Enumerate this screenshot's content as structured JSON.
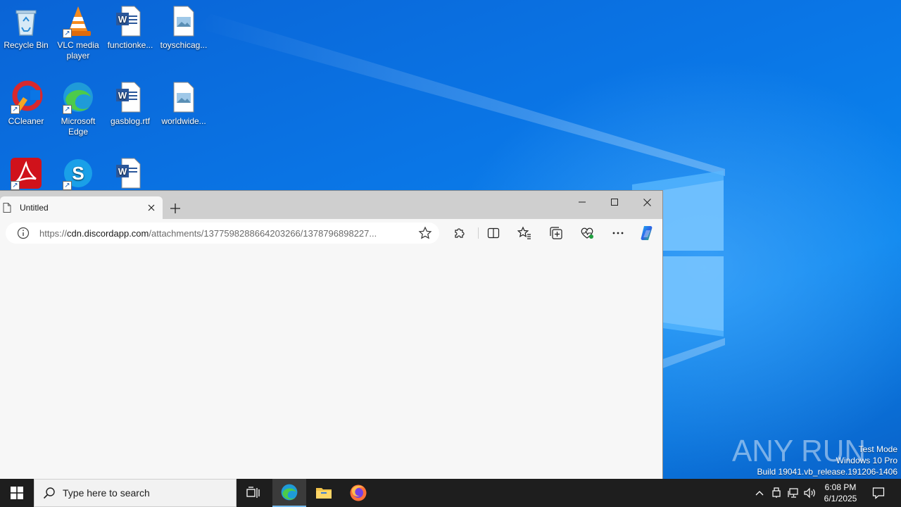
{
  "desktop": {
    "icons": [
      {
        "label": "Recycle Bin",
        "icon": "recycle-bin-icon"
      },
      {
        "label": "VLC media player",
        "icon": "vlc-icon"
      },
      {
        "label": "functionke...",
        "icon": "word-document-icon"
      },
      {
        "label": "toyschicag...",
        "icon": "image-file-icon"
      },
      {
        "label": "CCleaner",
        "icon": "ccleaner-icon"
      },
      {
        "label": "Microsoft Edge",
        "icon": "edge-icon"
      },
      {
        "label": "gasblog.rtf",
        "icon": "word-document-icon"
      },
      {
        "label": "worldwide...",
        "icon": "image-file-icon"
      },
      {
        "label": "",
        "icon": "acrobat-icon"
      },
      {
        "label": "",
        "icon": "skype-icon"
      },
      {
        "label": "",
        "icon": "word-document-icon"
      }
    ]
  },
  "browser": {
    "tab_title": "Untitled",
    "url_prefix": "https://",
    "url_host": "cdn.discordapp.com",
    "url_path": "/attachments/1377598288664203266/1378796898227...",
    "accent": "#0a64d6"
  },
  "watermark": {
    "brand": "ANY RUN",
    "mode": "Test Mode",
    "os": "Windows 10 Pro",
    "build": "Build 19041.vb_release.191206-1406"
  },
  "taskbar": {
    "search_placeholder": "Type here to search",
    "time": "6:08 PM",
    "date": "6/1/2025"
  }
}
